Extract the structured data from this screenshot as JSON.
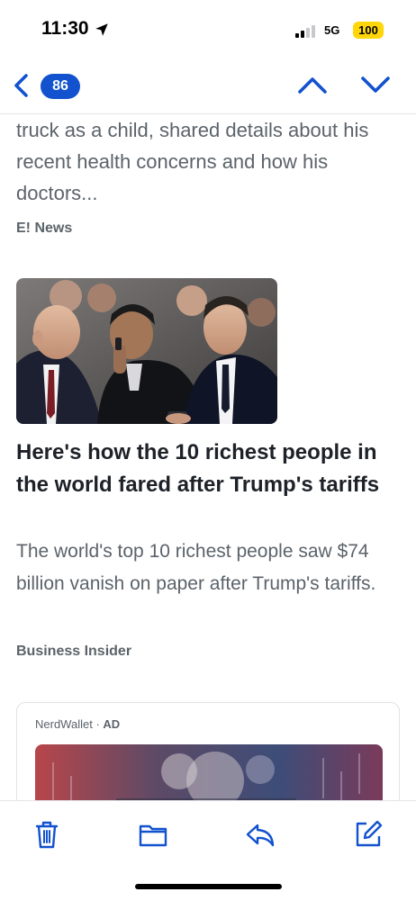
{
  "status_bar": {
    "time": "11:30",
    "network": "5G",
    "battery": "100"
  },
  "nav": {
    "unread_count": "86"
  },
  "articles": [
    {
      "snippet": "truck as a child, shared details about his recent health concerns and how his doctors...",
      "source": "E! News"
    },
    {
      "headline": "Here's how the 10 richest people in the world fared after Trump's tariffs",
      "summary": "The world's top 10 richest people saw $74 billion vanish on paper after Trump's tariffs.",
      "source": "Business Insider"
    }
  ],
  "ad": {
    "advertiser": "NerdWallet",
    "separator": "·",
    "label": "AD"
  },
  "colors": {
    "accent": "#1252ce",
    "battery": "#ffd60a",
    "muted_text": "#5b636a"
  }
}
